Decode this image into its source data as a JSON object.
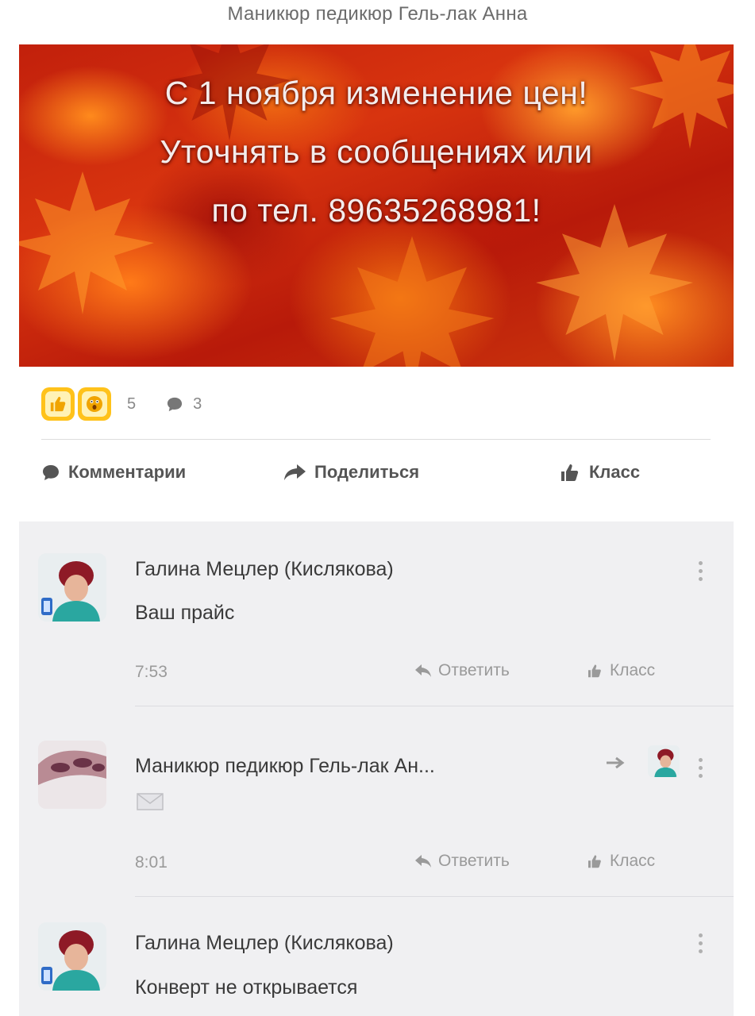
{
  "page": {
    "title": "Маникюр педикюр Гель-лак Анна"
  },
  "banner": {
    "lines": [
      "С 1 ноября изменение цен!",
      "Уточнять в сообщениях или",
      "по тел. 89635268981!"
    ]
  },
  "post_stats": {
    "reactions_count": "5",
    "comments_count": "3"
  },
  "actions": {
    "comments": "Комментарии",
    "share": "Поделиться",
    "like": "Класс"
  },
  "comments": [
    {
      "author": "Галина Мецлер (Кислякова)",
      "text": "Ваш прайс",
      "time": "7:53",
      "reply": "Ответить",
      "like": "Класс"
    },
    {
      "author": "Маникюр педикюр Гель-лак Ан...",
      "text": "",
      "time": "8:01",
      "reply": "Ответить",
      "like": "Класс"
    },
    {
      "author": "Галина Мецлер (Кислякова)",
      "text": "Конверт не открывается"
    }
  ],
  "colors": {
    "reaction_badge": "#ffc21a",
    "comment_bg": "#f0f0f2",
    "banner_red": "#c2200c",
    "banner_orange": "#ff8a1c"
  }
}
